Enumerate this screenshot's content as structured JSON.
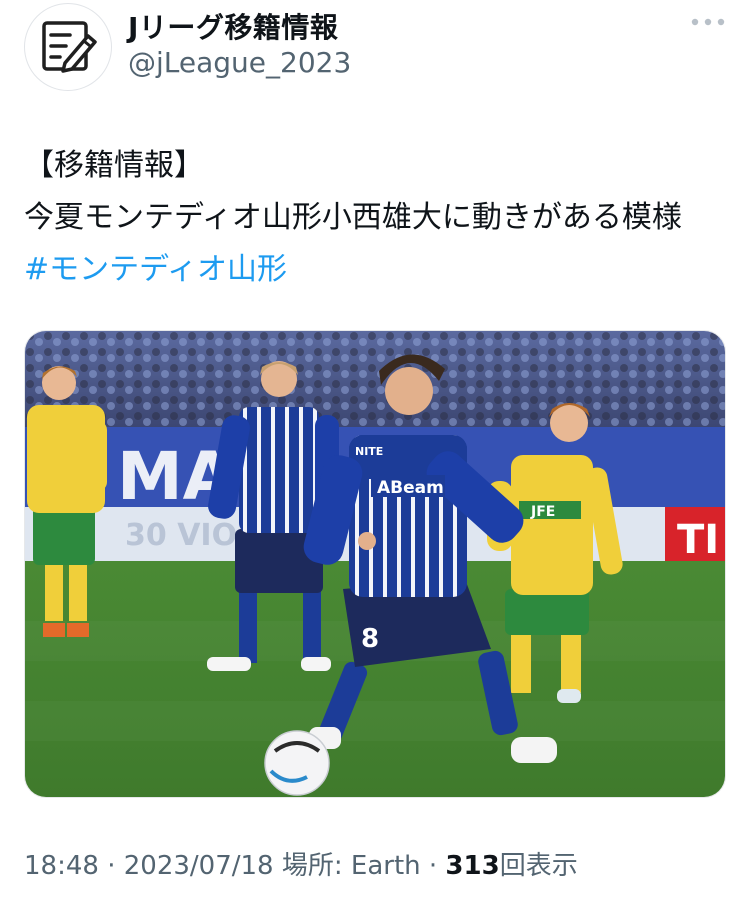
{
  "author": {
    "display_name": "Jリーグ移籍情報",
    "handle": "@jLeague_2023",
    "avatar_icon": "document-pen-icon"
  },
  "more_icon": "more-options-icon",
  "tweet": {
    "line1": "【移籍情報】",
    "line2": "今夏モンテディオ山形小西雄大に動きがある模様",
    "hashtag": "#モンテディオ山形"
  },
  "photo": {
    "banner_left": "MAG",
    "banner_right": "TI",
    "board_text": "30 VIO",
    "home_sponsor": "ABeam",
    "home_sponsor_small": "NITE",
    "home_number": "8",
    "away_sponsor": "JFE",
    "colors": {
      "home_kit": "#1d3f9e",
      "away_kit": "#f2d23c",
      "away_shorts": "#2d8a3e",
      "pitch": "#4f8a36"
    }
  },
  "meta": {
    "time": "18:48",
    "date": "2023/07/18",
    "location_label": "場所:",
    "location": "Earth",
    "views_count": "313",
    "views_label": "回表示",
    "separator": "·"
  }
}
